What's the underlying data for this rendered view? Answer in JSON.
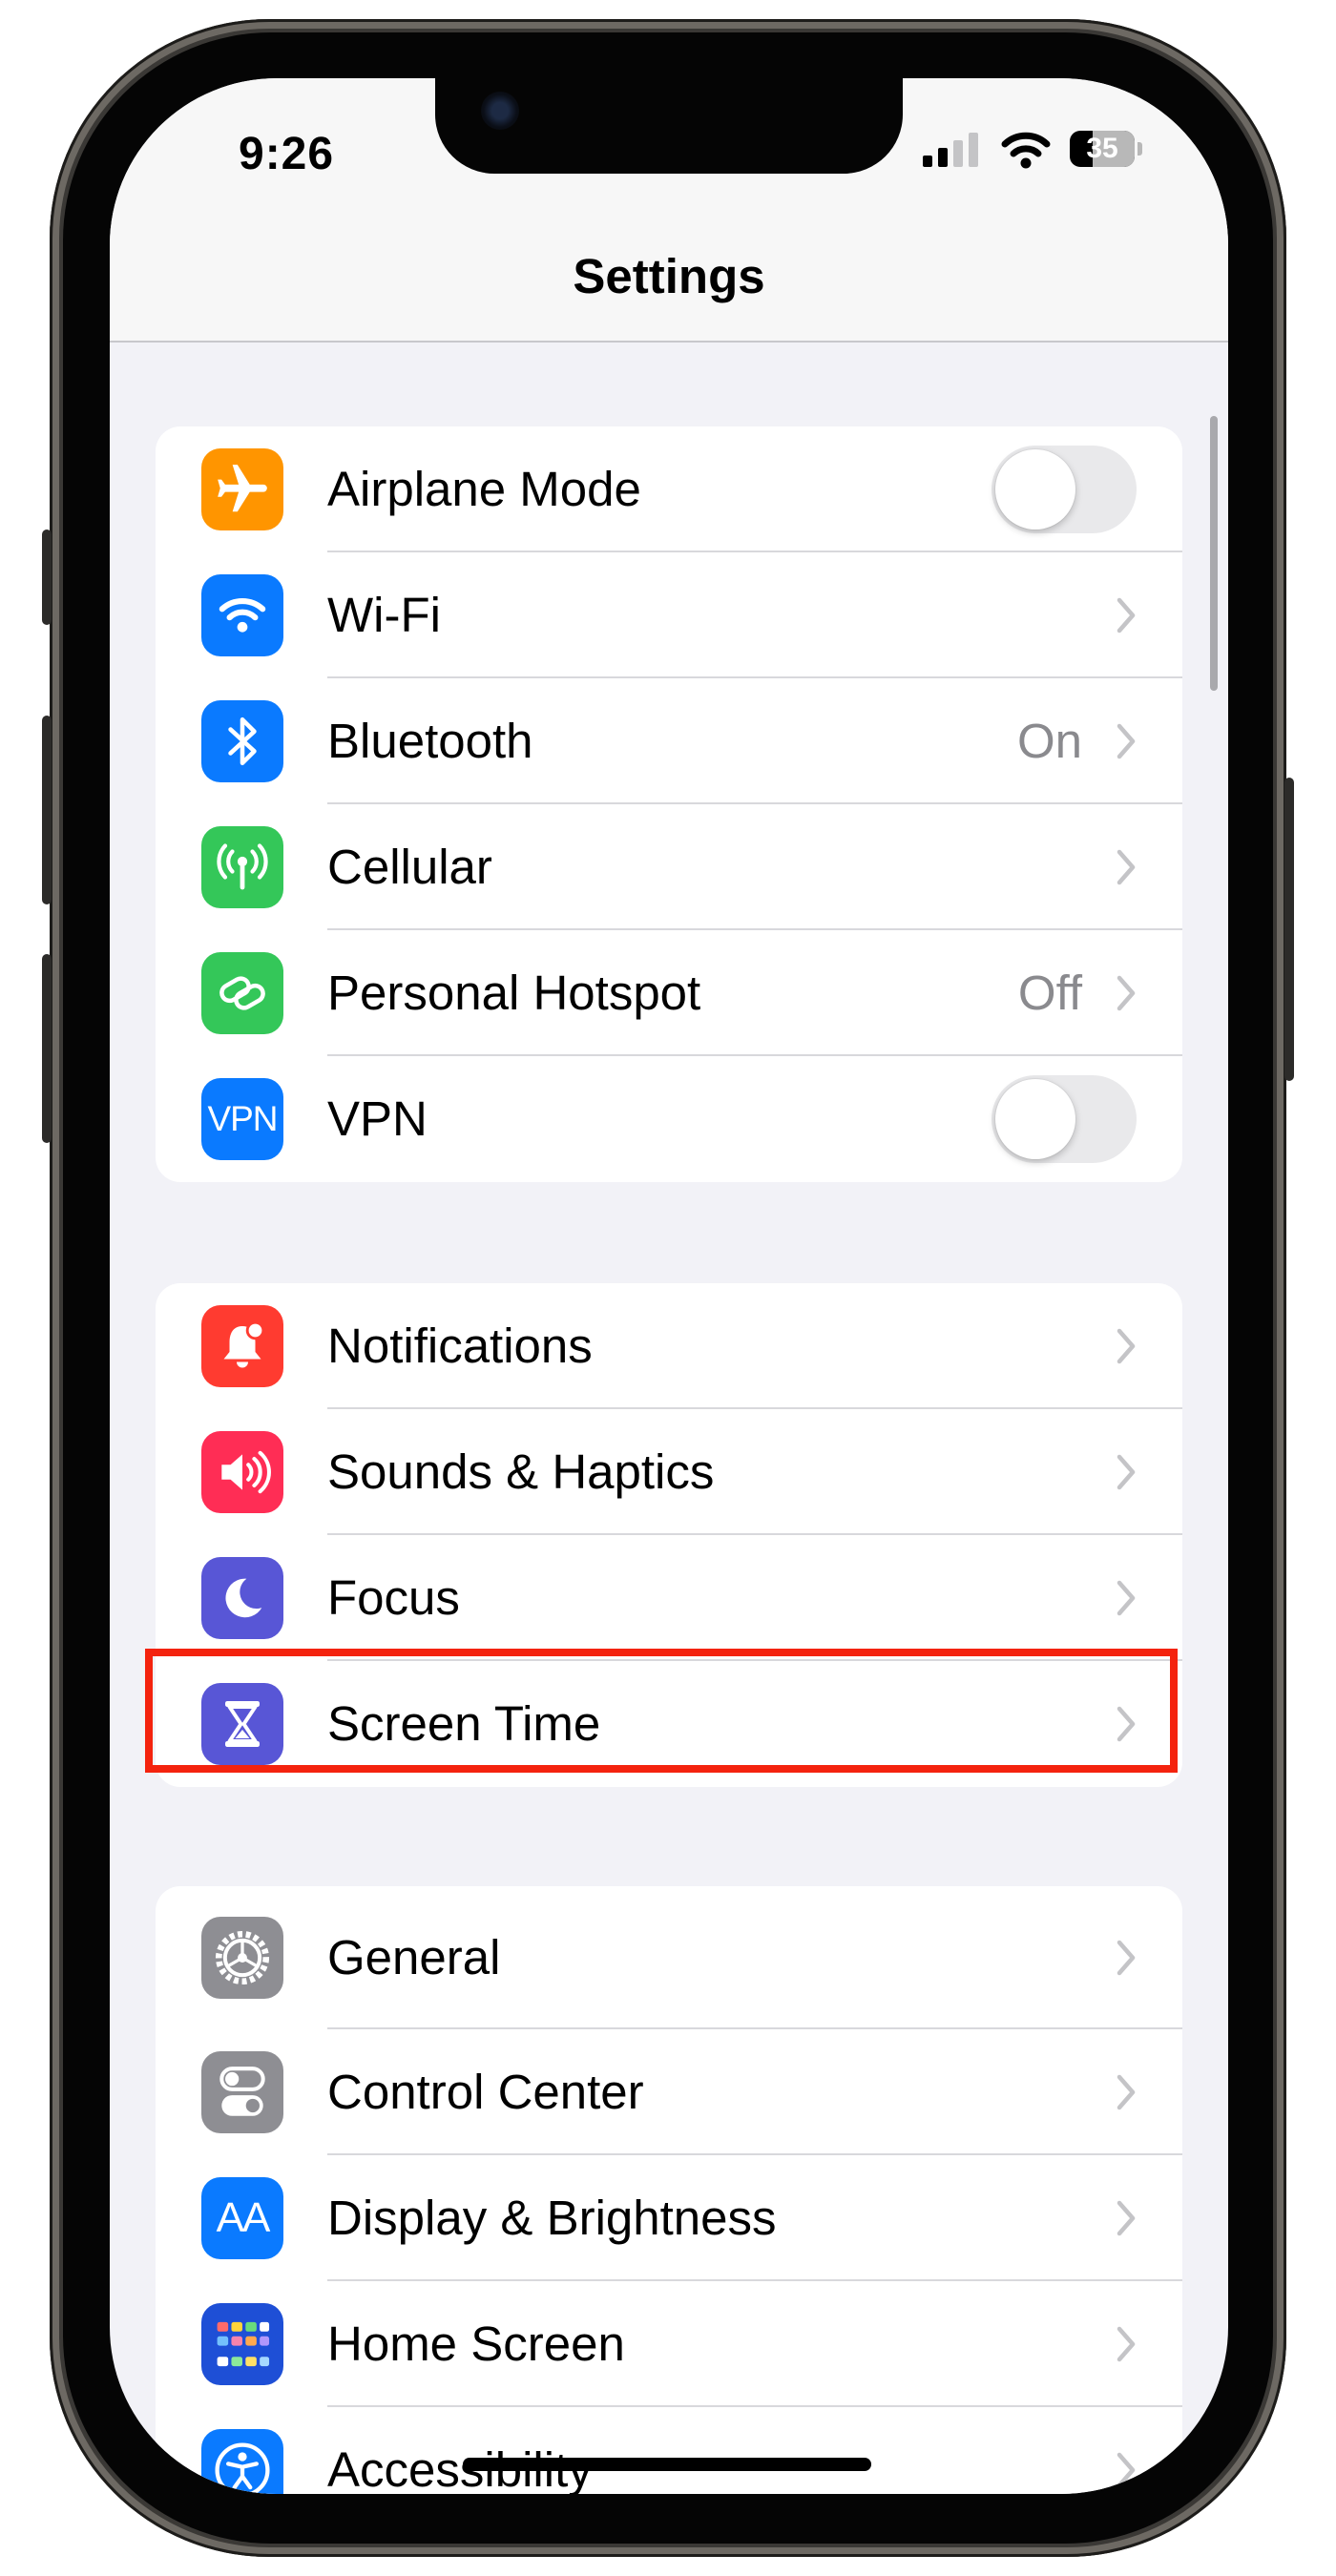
{
  "status_bar": {
    "time": "9:26",
    "battery": "35"
  },
  "nav": {
    "title": "Settings"
  },
  "colors": {
    "orange": "#ff9500",
    "blue": "#0a7aff",
    "green": "#34c759",
    "red": "#ff3b30",
    "pink": "#ff2d55",
    "indigo": "#5856d6",
    "gray": "#8e8e93",
    "highlight": "#f4230e"
  },
  "groups": [
    {
      "items": [
        {
          "label": "Airplane Mode",
          "icon": "airplane-icon",
          "toggle_on": false
        },
        {
          "label": "Wi-Fi",
          "icon": "wifi-icon"
        },
        {
          "label": "Bluetooth",
          "icon": "bluetooth-icon",
          "value": "On"
        },
        {
          "label": "Cellular",
          "icon": "cellular-antenna-icon"
        },
        {
          "label": "Personal Hotspot",
          "icon": "hotspot-chain-icon",
          "value": "Off"
        },
        {
          "label": "VPN",
          "icon": "vpn-icon",
          "icon_text": "VPN",
          "toggle_on": false
        }
      ]
    },
    {
      "items": [
        {
          "label": "Notifications",
          "icon": "bell-icon"
        },
        {
          "label": "Sounds & Haptics",
          "icon": "speaker-icon"
        },
        {
          "label": "Focus",
          "icon": "moon-icon"
        },
        {
          "label": "Screen Time",
          "icon": "hourglass-icon"
        }
      ]
    },
    {
      "items": [
        {
          "label": "General",
          "icon": "gear-icon"
        },
        {
          "label": "Control Center",
          "icon": "switches-icon"
        },
        {
          "label": "Display & Brightness",
          "icon": "text-size-icon",
          "icon_text": "AA"
        },
        {
          "label": "Home Screen",
          "icon": "app-grid-icon"
        },
        {
          "label": "Accessibility",
          "icon": "accessibility-icon"
        }
      ]
    }
  ]
}
